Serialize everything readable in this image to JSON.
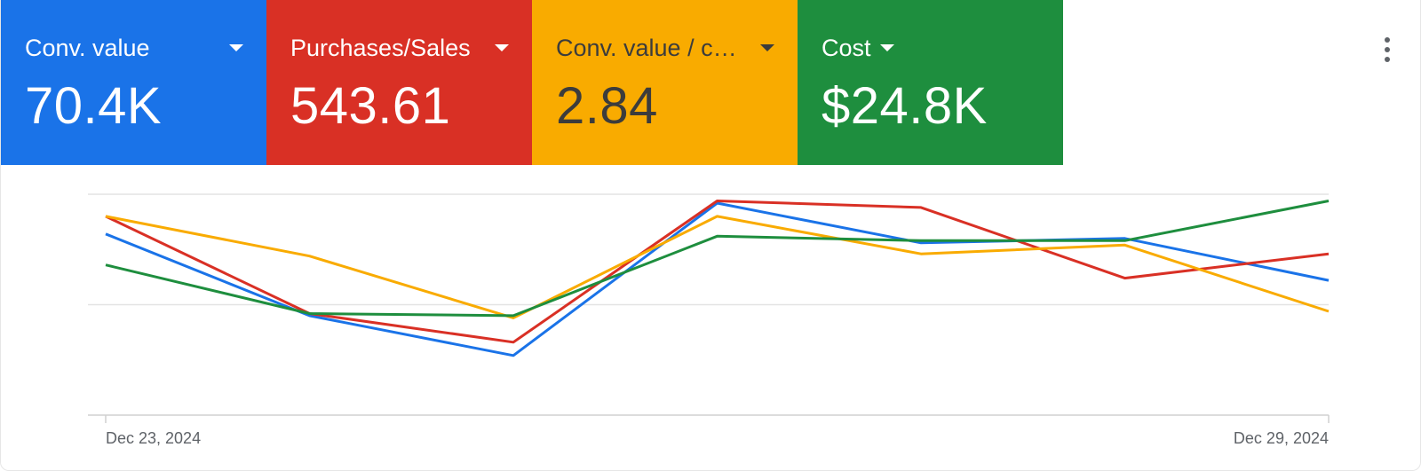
{
  "metrics": [
    {
      "label": "Conv. value",
      "value": "70.4K",
      "color": "#1a73e8"
    },
    {
      "label": "Purchases/Sales",
      "value": "543.61",
      "color": "#d93025"
    },
    {
      "label": "Conv. value / c…",
      "value": "2.84",
      "color": "#f9ab00"
    },
    {
      "label": "Cost",
      "value": "$24.8K",
      "color": "#1e8e3e"
    }
  ],
  "more_menu_icon": "more-vert-icon",
  "chart_data": {
    "type": "line",
    "x": [
      "2024-12-23",
      "2024-12-24",
      "2024-12-25",
      "2024-12-26",
      "2024-12-27",
      "2024-12-28",
      "2024-12-29"
    ],
    "x_tick_labels": [
      "Dec 23, 2024",
      "Dec 29, 2024"
    ],
    "grid": true,
    "series": [
      {
        "metric": "Conv. value",
        "color": "#1a73e8",
        "values": [
          0.82,
          0.45,
          0.27,
          0.96,
          0.78,
          0.8,
          0.61
        ]
      },
      {
        "metric": "Purchases/Sales",
        "color": "#d93025",
        "values": [
          0.9,
          0.46,
          0.33,
          0.97,
          0.94,
          0.62,
          0.73
        ]
      },
      {
        "metric": "Conv. value / cost",
        "color": "#f9ab00",
        "values": [
          0.9,
          0.72,
          0.44,
          0.9,
          0.73,
          0.77,
          0.47
        ]
      },
      {
        "metric": "Cost",
        "color": "#1e8e3e",
        "values": [
          0.68,
          0.46,
          0.45,
          0.81,
          0.79,
          0.79,
          0.97
        ]
      }
    ]
  }
}
